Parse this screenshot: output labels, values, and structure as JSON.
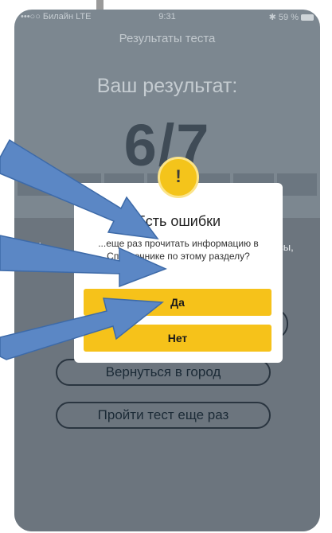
{
  "status_bar": {
    "carrier": "•••○○ Билайн  LTE",
    "time": "9:31",
    "battery": "✱ 59 %"
  },
  "screen": {
    "title": "Результаты теста",
    "result_label": "Ваш результат:",
    "score": "6/7",
    "bg_text_left": "Если",
    "bg_text_right": "осы,",
    "buttons": {
      "back_to_city": "Вернуться в  город",
      "retake_test": "Пройти тест еще раз"
    }
  },
  "dialog": {
    "icon_glyph": "!",
    "title": "Есть ошибки",
    "message": "...еще раз прочитать информацию в Справочнике по этому разделу?",
    "yes_label": "Да",
    "no_label": "Нет"
  },
  "colors": {
    "accent": "#f6c21a",
    "overlay": "#7c8790",
    "annotation_arrow": "#5b87c5"
  }
}
